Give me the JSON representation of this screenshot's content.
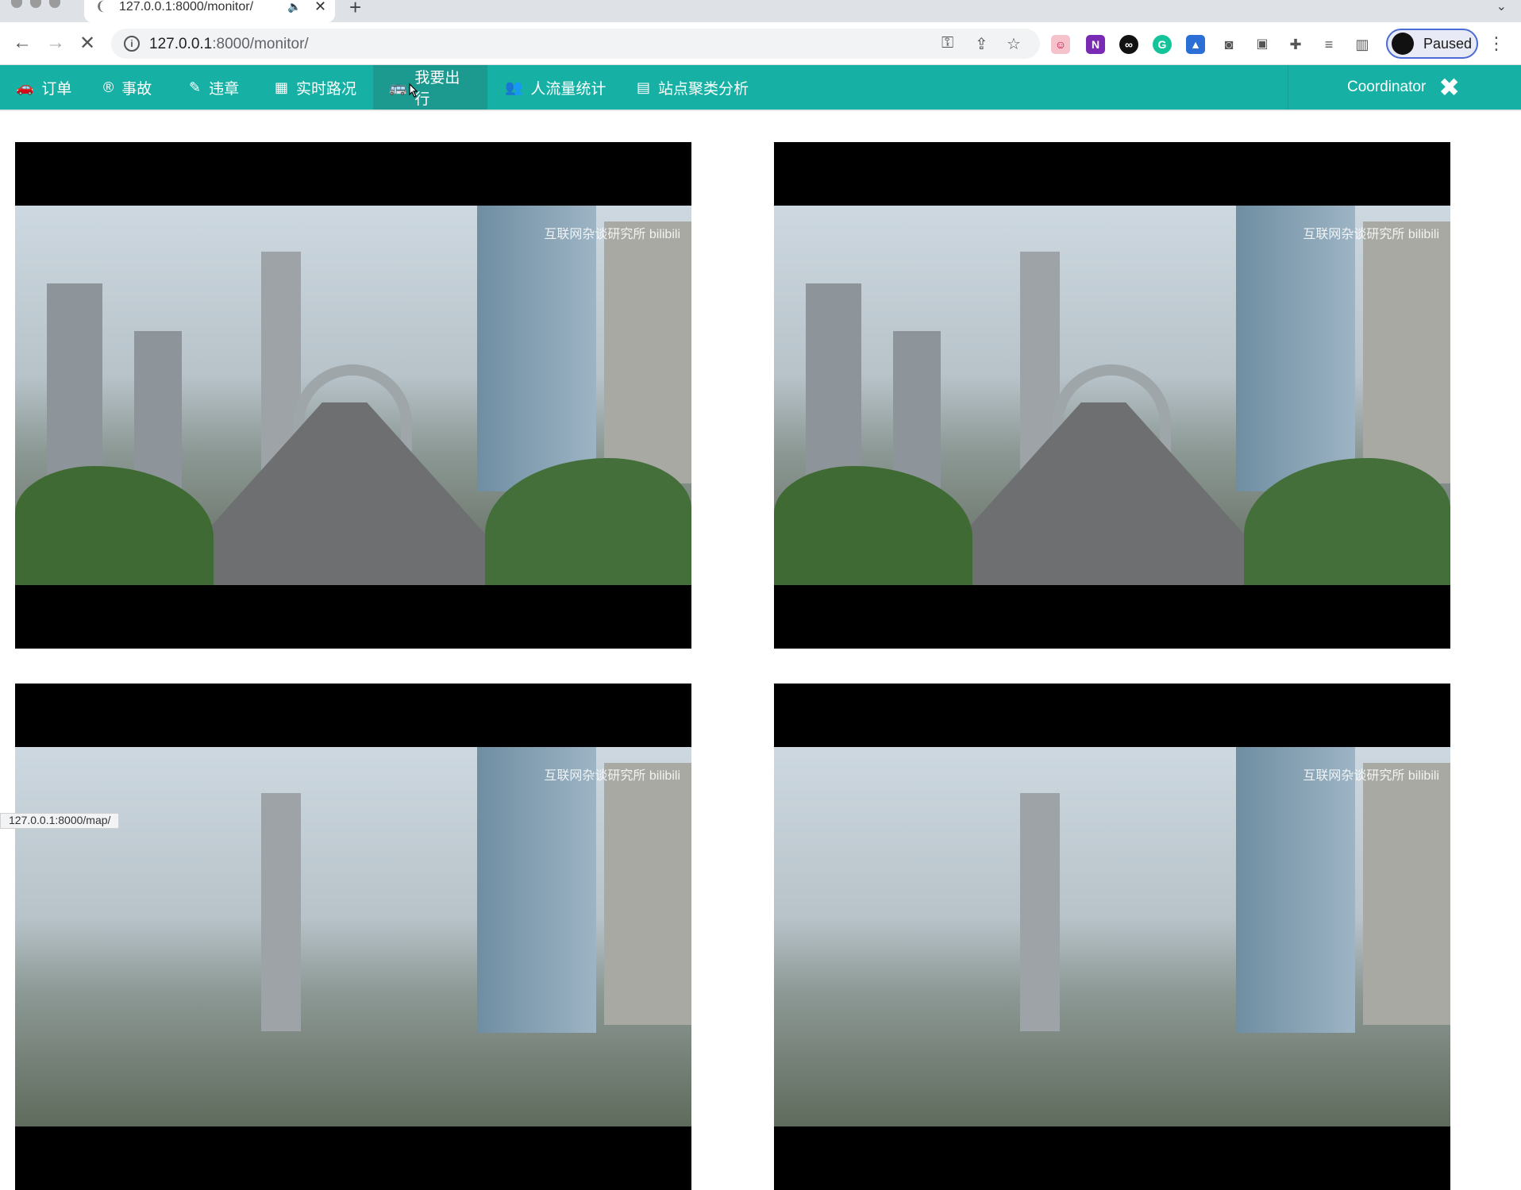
{
  "browser": {
    "tab_title": "127.0.0.1:8000/monitor/",
    "new_tab": "+",
    "url_host": "127.0.0.1",
    "url_path": ":8000/monitor/",
    "profile_label": "Paused",
    "status_url": "127.0.0.1:8000/map/"
  },
  "nav": {
    "items": [
      {
        "label": "订单",
        "icon": "car-icon"
      },
      {
        "label": "事故",
        "icon": "registered-icon"
      },
      {
        "label": "违章",
        "icon": "pencil-icon"
      },
      {
        "label": "实时路况",
        "icon": "film-icon"
      },
      {
        "label": "我要出行",
        "icon": "bus-icon"
      },
      {
        "label": "人流量统计",
        "icon": "users-icon"
      },
      {
        "label": "站点聚类分析",
        "icon": "calculator-icon"
      }
    ],
    "active_index": 4,
    "user": "Coordinator",
    "close_icon": "close-icon",
    "bar_color": "#16b1a4"
  },
  "videos": {
    "watermark": "互联网杂谈研究所 bilibili",
    "count": 4
  }
}
